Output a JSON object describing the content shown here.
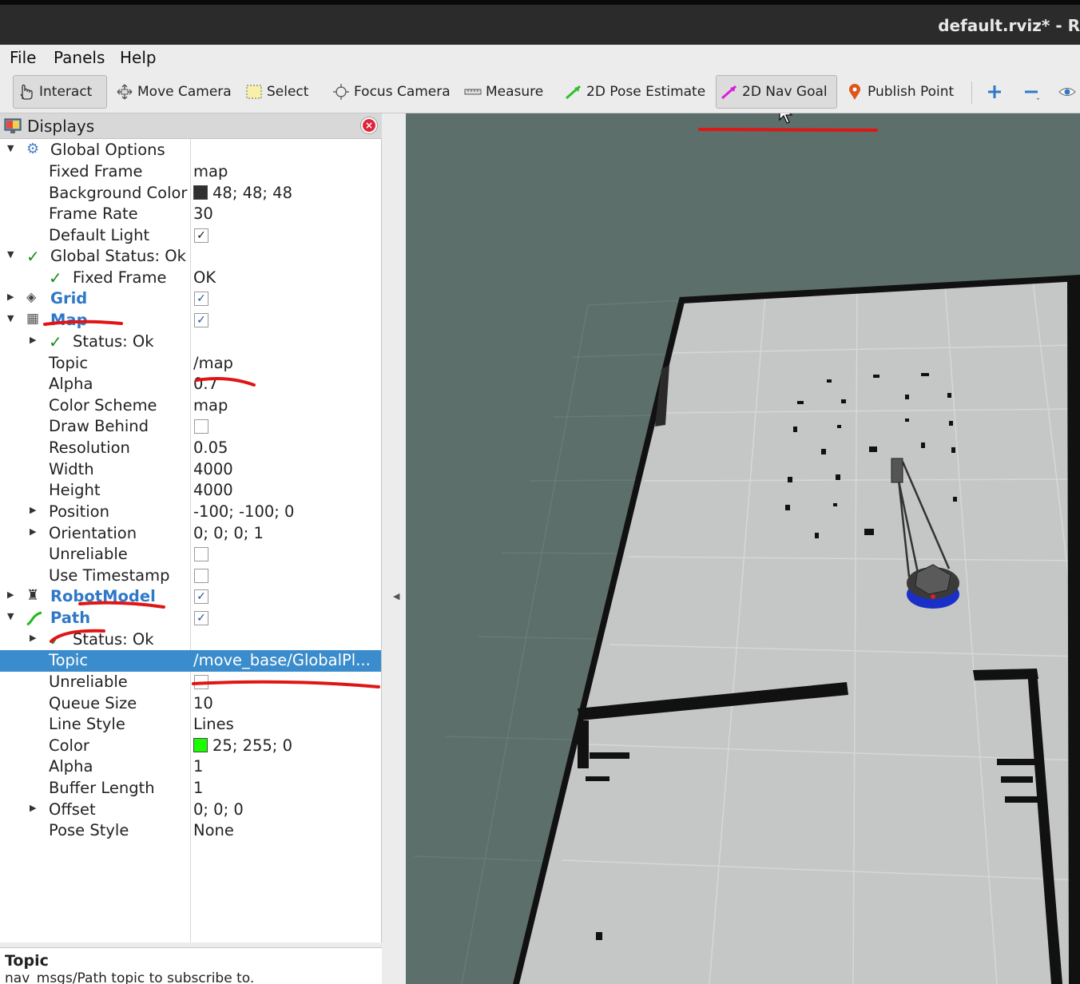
{
  "window": {
    "title": "default.rviz* - R"
  },
  "menu": {
    "file": "File",
    "panels": "Panels",
    "help": "Help"
  },
  "toolbar": {
    "interact": "Interact",
    "move_camera": "Move Camera",
    "select": "Select",
    "focus_camera": "Focus Camera",
    "measure": "Measure",
    "pose_estimate": "2D Pose Estimate",
    "nav_goal": "2D Nav Goal",
    "publish_point": "Publish Point",
    "zoom_in": "+",
    "zoom_out": "−"
  },
  "displays": {
    "header": "Displays",
    "rows": [
      {
        "name": "Global Options",
        "value": ""
      },
      {
        "name": "Fixed Frame",
        "value": "map"
      },
      {
        "name": "Background Color",
        "value": "48; 48; 48"
      },
      {
        "name": "Frame Rate",
        "value": "30"
      },
      {
        "name": "Default Light",
        "value": ""
      },
      {
        "name": "Global Status: Ok",
        "value": ""
      },
      {
        "name": "Fixed Frame",
        "value": "OK"
      },
      {
        "name": "Grid",
        "value": ""
      },
      {
        "name": "Map",
        "value": ""
      },
      {
        "name": "Status: Ok",
        "value": ""
      },
      {
        "name": "Topic",
        "value": "/map"
      },
      {
        "name": "Alpha",
        "value": "0.7"
      },
      {
        "name": "Color Scheme",
        "value": "map"
      },
      {
        "name": "Draw Behind",
        "value": ""
      },
      {
        "name": "Resolution",
        "value": "0.05"
      },
      {
        "name": "Width",
        "value": "4000"
      },
      {
        "name": "Height",
        "value": "4000"
      },
      {
        "name": "Position",
        "value": "-100; -100; 0"
      },
      {
        "name": "Orientation",
        "value": "0; 0; 0; 1"
      },
      {
        "name": "Unreliable",
        "value": ""
      },
      {
        "name": "Use Timestamp",
        "value": ""
      },
      {
        "name": "RobotModel",
        "value": ""
      },
      {
        "name": "Path",
        "value": ""
      },
      {
        "name": "Status: Ok",
        "value": ""
      },
      {
        "name": "Topic",
        "value": "/move_base/GlobalPl..."
      },
      {
        "name": "Unreliable",
        "value": ""
      },
      {
        "name": "Queue Size",
        "value": "10"
      },
      {
        "name": "Line Style",
        "value": "Lines"
      },
      {
        "name": "Color",
        "value": "25; 255; 0"
      },
      {
        "name": "Alpha",
        "value": "1"
      },
      {
        "name": "Buffer Length",
        "value": "1"
      },
      {
        "name": "Offset",
        "value": "0; 0; 0"
      },
      {
        "name": "Pose Style",
        "value": "None"
      }
    ]
  },
  "colors": {
    "background_color": "#303030",
    "path_color": "#19ff00",
    "selection": "#3a8ccc",
    "viewport_bg": "#5c6f6b",
    "annotation": "#e01515"
  },
  "help": {
    "title": "Topic",
    "text": "nav_msgs/Path topic to subscribe to."
  }
}
